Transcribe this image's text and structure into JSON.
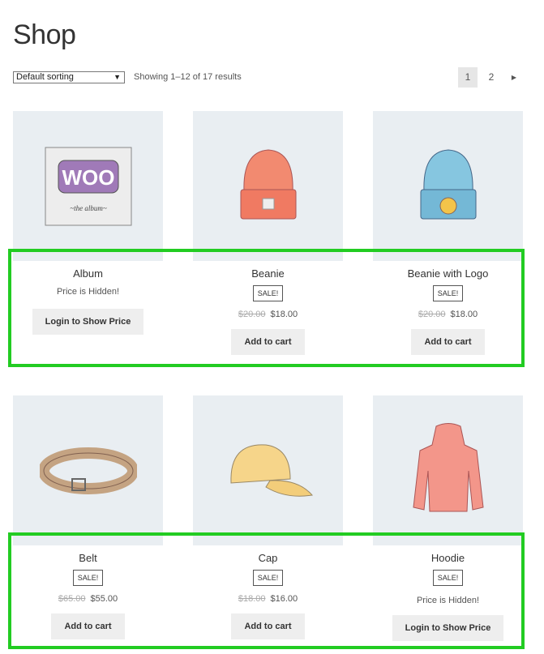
{
  "page_title": "Shop",
  "sorting": {
    "selected": "Default sorting"
  },
  "result_count": "Showing 1–12 of 17 results",
  "pagination": {
    "pages": [
      "1",
      "2"
    ],
    "current": "1",
    "next_icon": "triangle-right-icon"
  },
  "highlight_color": "#22cc22",
  "products": [
    {
      "name": "Album",
      "price_hidden": "Price is Hidden!",
      "button": "Login to Show Price",
      "image": "woo-album"
    },
    {
      "name": "Beanie",
      "sale": "SALE!",
      "old_price": "$20.00",
      "price": "$18.00",
      "button": "Add to cart",
      "image": "orange-beanie"
    },
    {
      "name": "Beanie with Logo",
      "sale": "SALE!",
      "old_price": "$20.00",
      "price": "$18.00",
      "button": "Add to cart",
      "image": "blue-beanie"
    },
    {
      "name": "Belt",
      "sale": "SALE!",
      "old_price": "$65.00",
      "price": "$55.00",
      "button": "Add to cart",
      "image": "belt"
    },
    {
      "name": "Cap",
      "sale": "SALE!",
      "old_price": "$18.00",
      "price": "$16.00",
      "button": "Add to cart",
      "image": "cap"
    },
    {
      "name": "Hoodie",
      "sale": "SALE!",
      "price_hidden": "Price is Hidden!",
      "button": "Login to Show Price",
      "image": "hoodie"
    }
  ],
  "album_logo_text": "WOO"
}
